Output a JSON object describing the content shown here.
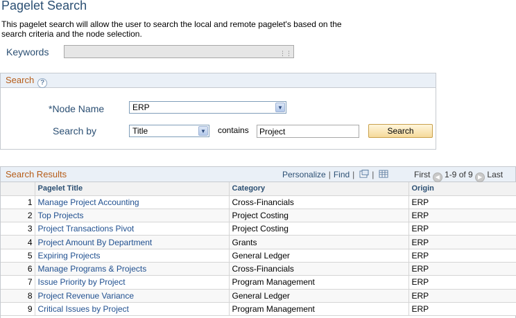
{
  "page": {
    "title": "Pagelet Search",
    "description": "This pagelet search will allow the user to search the local and remote pagelet's based on the search criteria and the node selection."
  },
  "keywords": {
    "label": "Keywords",
    "value": ""
  },
  "search": {
    "section_title": "Search",
    "help_icon": "help-icon",
    "node_label": "*Node Name",
    "node_value": "ERP",
    "searchby_label": "Search by",
    "searchby_value": "Title",
    "contains_label": "contains",
    "query_value": "Project",
    "button_label": "Search"
  },
  "results": {
    "title": "Search Results",
    "personalize": "Personalize",
    "find": "Find",
    "first": "First",
    "range": "1-9 of 9",
    "last": "Last",
    "columns": [
      "Pagelet Title",
      "Category",
      "Origin"
    ],
    "rows": [
      {
        "num": "1",
        "title": "Manage Project Accounting",
        "category": "Cross-Financials",
        "origin": "ERP"
      },
      {
        "num": "2",
        "title": "Top Projects",
        "category": "Project Costing",
        "origin": "ERP"
      },
      {
        "num": "3",
        "title": "Project Transactions Pivot",
        "category": "Project Costing",
        "origin": "ERP"
      },
      {
        "num": "4",
        "title": "Project Amount By Department",
        "category": "Grants",
        "origin": "ERP"
      },
      {
        "num": "5",
        "title": "Expiring Projects",
        "category": "General Ledger",
        "origin": "ERP"
      },
      {
        "num": "6",
        "title": "Manage Programs & Projects",
        "category": "Cross-Financials",
        "origin": "ERP"
      },
      {
        "num": "7",
        "title": "Issue Priority by Project",
        "category": "Program Management",
        "origin": "ERP"
      },
      {
        "num": "8",
        "title": "Project Revenue Variance",
        "category": "General Ledger",
        "origin": "ERP"
      },
      {
        "num": "9",
        "title": "Critical Issues by Project",
        "category": "Program Management",
        "origin": "ERP"
      }
    ]
  },
  "colors": {
    "heading": "#2b4f73",
    "section_title": "#b65c18",
    "link": "#1f4f8f",
    "header_bg": "#eaf0f7"
  }
}
